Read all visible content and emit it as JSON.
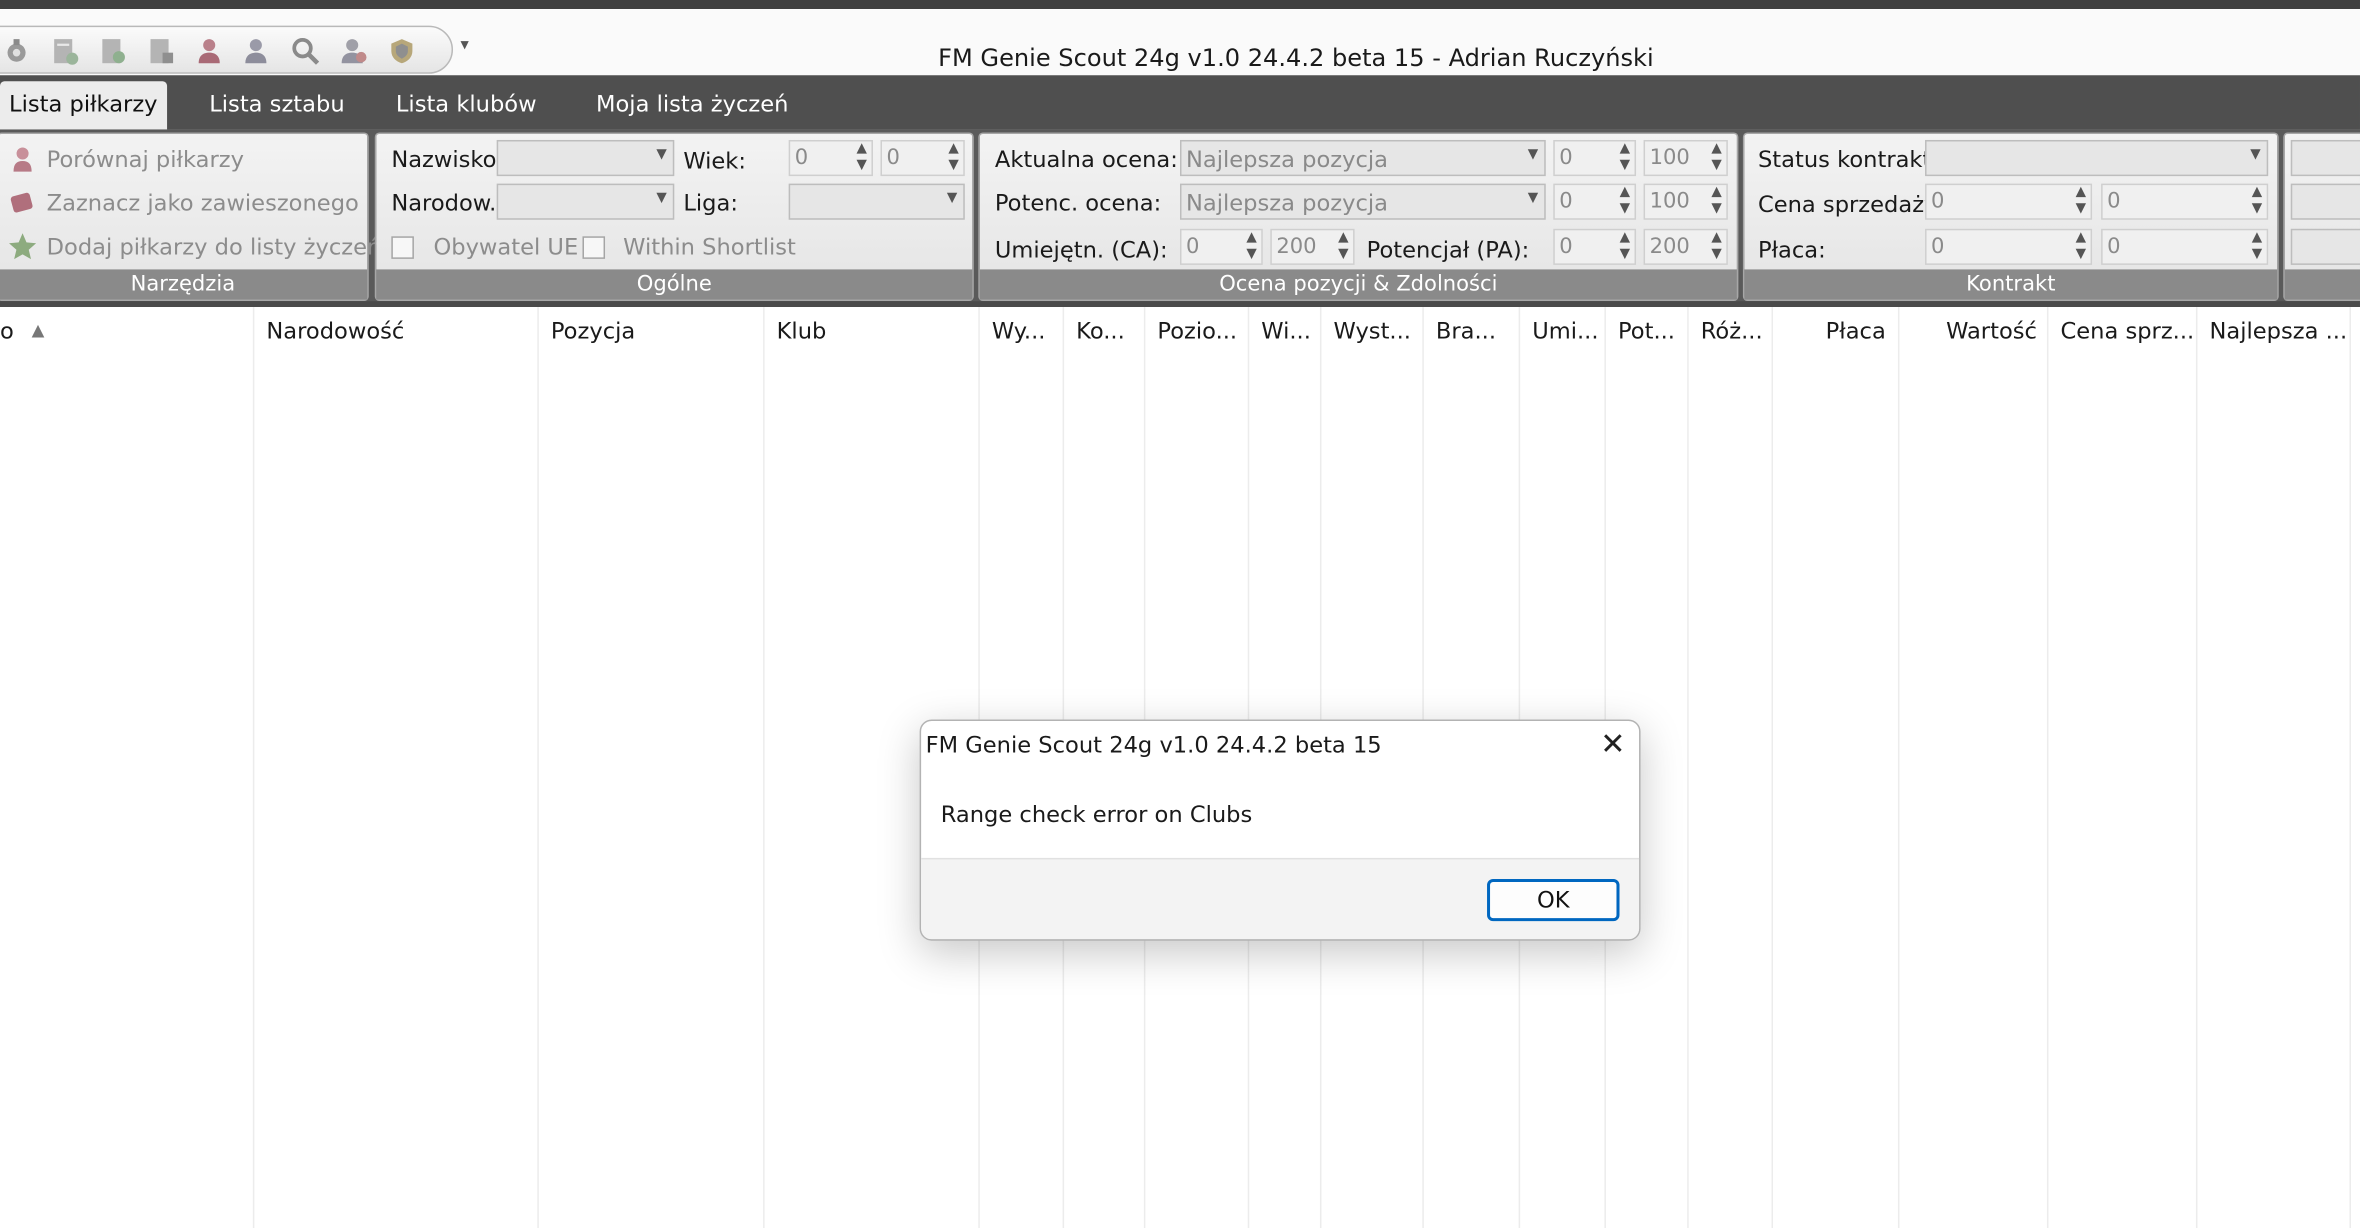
{
  "window": {
    "title": "FM Genie Scout 24g v1.0 24.4.2 beta 15 - Adrian Ruczyński"
  },
  "quick_access": {
    "icons": [
      "settings-icon",
      "page-add-icon",
      "page-refresh-icon",
      "page-save-icon",
      "person-icon",
      "person-search-icon",
      "search-icon",
      "person-remove-icon",
      "shield-icon"
    ],
    "more": "▾"
  },
  "tabs": [
    {
      "label": "Lista piłkarzy",
      "active": true
    },
    {
      "label": "Lista sztabu",
      "active": false
    },
    {
      "label": "Lista klubów",
      "active": false
    },
    {
      "label": "Moja lista życzeń",
      "active": false
    }
  ],
  "ribbon": {
    "tools": {
      "caption": "Narzędzia",
      "compare": "Porównaj piłkarzy",
      "mark_suspended": "Zaznacz jako zawieszonego",
      "add_wishlist": "Dodaj piłkarzy do listy życzeń"
    },
    "general": {
      "caption": "Ogólne",
      "surname_label": "Nazwisko:",
      "nationality_label": "Narodow.:",
      "age_label": "Wiek:",
      "age_min": "0",
      "age_max": "0",
      "league_label": "Liga:",
      "eu_label": "Obywatel UE",
      "shortlist_label": "Within Shortlist"
    },
    "rating": {
      "caption": "Ocena pozycji & Zdolności",
      "current_label": "Aktualna ocena:",
      "current_value": "Najlepsza pozycja",
      "current_min": "0",
      "current_max": "100",
      "potential_label": "Potenc. ocena:",
      "potential_value": "Najlepsza pozycja",
      "potential_min": "0",
      "potential_max": "100",
      "ca_label": "Umiejętn. (CA):",
      "ca_min": "0",
      "ca_max": "200",
      "pa_label": "Potencjał (PA):",
      "pa_min": "0",
      "pa_max": "200"
    },
    "contract": {
      "caption": "Kontrakt",
      "status_label": "Status kontraktu",
      "price_label": "Cena sprzedaży",
      "price_min": "0",
      "price_max": "0",
      "wage_label": "Płaca:",
      "wage_min": "0",
      "wage_max": "0"
    }
  },
  "table": {
    "sort_glyph": "▲",
    "columns": [
      "o",
      "Narodowość",
      "Pozycja",
      "Klub",
      "Wy...",
      "Ko...",
      "Pozio...",
      "Wi...",
      "Wyst...",
      "Bra...",
      "Umi...",
      "Pot...",
      "Róż...",
      "Płaca",
      "Wartość",
      "Cena sprz...",
      "Najlepsza ..."
    ]
  },
  "dialog": {
    "title": "FM Genie Scout 24g v1.0 24.4.2 beta 15",
    "message": "Range check error on Clubs",
    "ok": "OK",
    "close": "✕"
  }
}
